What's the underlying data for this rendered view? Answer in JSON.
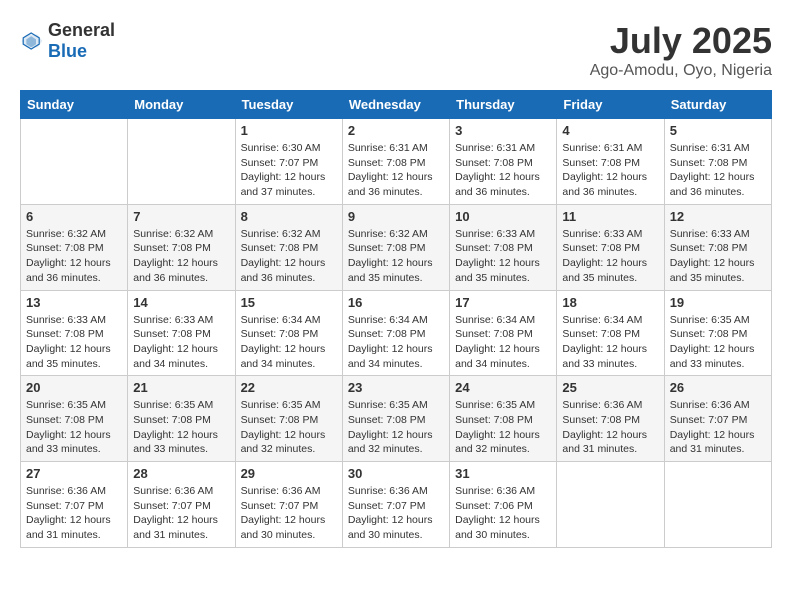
{
  "header": {
    "logo": {
      "general": "General",
      "blue": "Blue"
    },
    "title": "July 2025",
    "location": "Ago-Amodu, Oyo, Nigeria"
  },
  "calendar": {
    "columns": [
      "Sunday",
      "Monday",
      "Tuesday",
      "Wednesday",
      "Thursday",
      "Friday",
      "Saturday"
    ],
    "weeks": [
      [
        {
          "day": "",
          "sunrise": "",
          "sunset": "",
          "daylight": ""
        },
        {
          "day": "",
          "sunrise": "",
          "sunset": "",
          "daylight": ""
        },
        {
          "day": "1",
          "sunrise": "Sunrise: 6:30 AM",
          "sunset": "Sunset: 7:07 PM",
          "daylight": "Daylight: 12 hours and 37 minutes."
        },
        {
          "day": "2",
          "sunrise": "Sunrise: 6:31 AM",
          "sunset": "Sunset: 7:08 PM",
          "daylight": "Daylight: 12 hours and 36 minutes."
        },
        {
          "day": "3",
          "sunrise": "Sunrise: 6:31 AM",
          "sunset": "Sunset: 7:08 PM",
          "daylight": "Daylight: 12 hours and 36 minutes."
        },
        {
          "day": "4",
          "sunrise": "Sunrise: 6:31 AM",
          "sunset": "Sunset: 7:08 PM",
          "daylight": "Daylight: 12 hours and 36 minutes."
        },
        {
          "day": "5",
          "sunrise": "Sunrise: 6:31 AM",
          "sunset": "Sunset: 7:08 PM",
          "daylight": "Daylight: 12 hours and 36 minutes."
        }
      ],
      [
        {
          "day": "6",
          "sunrise": "Sunrise: 6:32 AM",
          "sunset": "Sunset: 7:08 PM",
          "daylight": "Daylight: 12 hours and 36 minutes."
        },
        {
          "day": "7",
          "sunrise": "Sunrise: 6:32 AM",
          "sunset": "Sunset: 7:08 PM",
          "daylight": "Daylight: 12 hours and 36 minutes."
        },
        {
          "day": "8",
          "sunrise": "Sunrise: 6:32 AM",
          "sunset": "Sunset: 7:08 PM",
          "daylight": "Daylight: 12 hours and 36 minutes."
        },
        {
          "day": "9",
          "sunrise": "Sunrise: 6:32 AM",
          "sunset": "Sunset: 7:08 PM",
          "daylight": "Daylight: 12 hours and 35 minutes."
        },
        {
          "day": "10",
          "sunrise": "Sunrise: 6:33 AM",
          "sunset": "Sunset: 7:08 PM",
          "daylight": "Daylight: 12 hours and 35 minutes."
        },
        {
          "day": "11",
          "sunrise": "Sunrise: 6:33 AM",
          "sunset": "Sunset: 7:08 PM",
          "daylight": "Daylight: 12 hours and 35 minutes."
        },
        {
          "day": "12",
          "sunrise": "Sunrise: 6:33 AM",
          "sunset": "Sunset: 7:08 PM",
          "daylight": "Daylight: 12 hours and 35 minutes."
        }
      ],
      [
        {
          "day": "13",
          "sunrise": "Sunrise: 6:33 AM",
          "sunset": "Sunset: 7:08 PM",
          "daylight": "Daylight: 12 hours and 35 minutes."
        },
        {
          "day": "14",
          "sunrise": "Sunrise: 6:33 AM",
          "sunset": "Sunset: 7:08 PM",
          "daylight": "Daylight: 12 hours and 34 minutes."
        },
        {
          "day": "15",
          "sunrise": "Sunrise: 6:34 AM",
          "sunset": "Sunset: 7:08 PM",
          "daylight": "Daylight: 12 hours and 34 minutes."
        },
        {
          "day": "16",
          "sunrise": "Sunrise: 6:34 AM",
          "sunset": "Sunset: 7:08 PM",
          "daylight": "Daylight: 12 hours and 34 minutes."
        },
        {
          "day": "17",
          "sunrise": "Sunrise: 6:34 AM",
          "sunset": "Sunset: 7:08 PM",
          "daylight": "Daylight: 12 hours and 34 minutes."
        },
        {
          "day": "18",
          "sunrise": "Sunrise: 6:34 AM",
          "sunset": "Sunset: 7:08 PM",
          "daylight": "Daylight: 12 hours and 33 minutes."
        },
        {
          "day": "19",
          "sunrise": "Sunrise: 6:35 AM",
          "sunset": "Sunset: 7:08 PM",
          "daylight": "Daylight: 12 hours and 33 minutes."
        }
      ],
      [
        {
          "day": "20",
          "sunrise": "Sunrise: 6:35 AM",
          "sunset": "Sunset: 7:08 PM",
          "daylight": "Daylight: 12 hours and 33 minutes."
        },
        {
          "day": "21",
          "sunrise": "Sunrise: 6:35 AM",
          "sunset": "Sunset: 7:08 PM",
          "daylight": "Daylight: 12 hours and 33 minutes."
        },
        {
          "day": "22",
          "sunrise": "Sunrise: 6:35 AM",
          "sunset": "Sunset: 7:08 PM",
          "daylight": "Daylight: 12 hours and 32 minutes."
        },
        {
          "day": "23",
          "sunrise": "Sunrise: 6:35 AM",
          "sunset": "Sunset: 7:08 PM",
          "daylight": "Daylight: 12 hours and 32 minutes."
        },
        {
          "day": "24",
          "sunrise": "Sunrise: 6:35 AM",
          "sunset": "Sunset: 7:08 PM",
          "daylight": "Daylight: 12 hours and 32 minutes."
        },
        {
          "day": "25",
          "sunrise": "Sunrise: 6:36 AM",
          "sunset": "Sunset: 7:08 PM",
          "daylight": "Daylight: 12 hours and 31 minutes."
        },
        {
          "day": "26",
          "sunrise": "Sunrise: 6:36 AM",
          "sunset": "Sunset: 7:07 PM",
          "daylight": "Daylight: 12 hours and 31 minutes."
        }
      ],
      [
        {
          "day": "27",
          "sunrise": "Sunrise: 6:36 AM",
          "sunset": "Sunset: 7:07 PM",
          "daylight": "Daylight: 12 hours and 31 minutes."
        },
        {
          "day": "28",
          "sunrise": "Sunrise: 6:36 AM",
          "sunset": "Sunset: 7:07 PM",
          "daylight": "Daylight: 12 hours and 31 minutes."
        },
        {
          "day": "29",
          "sunrise": "Sunrise: 6:36 AM",
          "sunset": "Sunset: 7:07 PM",
          "daylight": "Daylight: 12 hours and 30 minutes."
        },
        {
          "day": "30",
          "sunrise": "Sunrise: 6:36 AM",
          "sunset": "Sunset: 7:07 PM",
          "daylight": "Daylight: 12 hours and 30 minutes."
        },
        {
          "day": "31",
          "sunrise": "Sunrise: 6:36 AM",
          "sunset": "Sunset: 7:06 PM",
          "daylight": "Daylight: 12 hours and 30 minutes."
        },
        {
          "day": "",
          "sunrise": "",
          "sunset": "",
          "daylight": ""
        },
        {
          "day": "",
          "sunrise": "",
          "sunset": "",
          "daylight": ""
        }
      ]
    ]
  }
}
